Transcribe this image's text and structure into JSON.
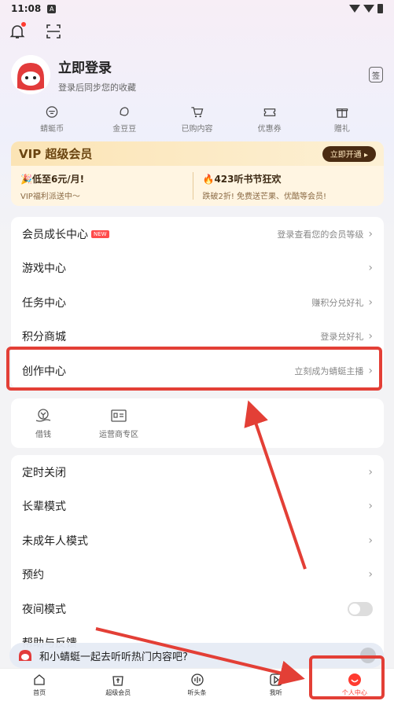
{
  "status": {
    "time": "11:08",
    "notif": "A"
  },
  "profile": {
    "title": "立即登录",
    "subtitle": "登录后同步您的收藏",
    "sign": "签"
  },
  "quick": [
    "蜻蜓币",
    "金豆豆",
    "已购内容",
    "优惠券",
    "赠礼"
  ],
  "vip": {
    "title": "VIP 超级会员",
    "button": "立即开通 ▸",
    "left_title": "🎉低至6元/月!",
    "left_sub": "VIP福利派送中～",
    "right_title": "🔥423听书节狂欢",
    "right_sub": "跌破2折! 免费送芒果、优酷等会员!"
  },
  "menu1": [
    {
      "label": "会员成长中心",
      "badge": "NEW",
      "right": "登录查看您的会员等级"
    },
    {
      "label": "游戏中心",
      "right": ""
    },
    {
      "label": "任务中心",
      "right": "赚积分兑好礼"
    },
    {
      "label": "积分商城",
      "right": "登录兑好礼"
    },
    {
      "label": "创作中心",
      "right": "立刻成为蜻蜓主播"
    }
  ],
  "tools": [
    "借钱",
    "运营商专区"
  ],
  "menu2": [
    {
      "label": "定时关闭"
    },
    {
      "label": "长辈模式"
    },
    {
      "label": "未成年人模式"
    },
    {
      "label": "预约"
    },
    {
      "label": "夜间模式"
    },
    {
      "label": "帮助与反馈"
    }
  ],
  "chat": {
    "text": "和小蜻蜓一起去听听热门内容吧?"
  },
  "tabs": [
    "首页",
    "超级会员",
    "听头条",
    "我听",
    "个人中心"
  ],
  "colors": {
    "accent": "#ff3b30",
    "highlight": "#e33f36",
    "vip_dark": "#4a2b12"
  }
}
